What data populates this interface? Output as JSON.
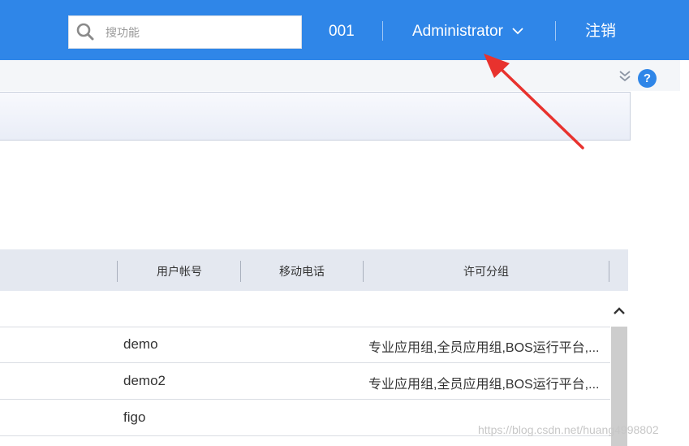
{
  "topbar": {
    "search_placeholder": "搜功能",
    "org_code": "001",
    "user_name": "Administrator",
    "logout_label": "注销"
  },
  "help": {
    "label": "?"
  },
  "table": {
    "columns": [
      "用户帐号",
      "移动电话",
      "许可分组"
    ],
    "rows": [
      {
        "account": "demo",
        "phone": "",
        "groups": "专业应用组,全员应用组,BOS运行平台,..."
      },
      {
        "account": "demo2",
        "phone": "",
        "groups": "专业应用组,全员应用组,BOS运行平台,..."
      },
      {
        "account": "figo",
        "phone": "",
        "groups": ""
      }
    ]
  },
  "watermark": "https://blog.csdn.net/huang4998802",
  "colors": {
    "topbar": "#2f86e8",
    "annotation_arrow": "#e8322e"
  }
}
